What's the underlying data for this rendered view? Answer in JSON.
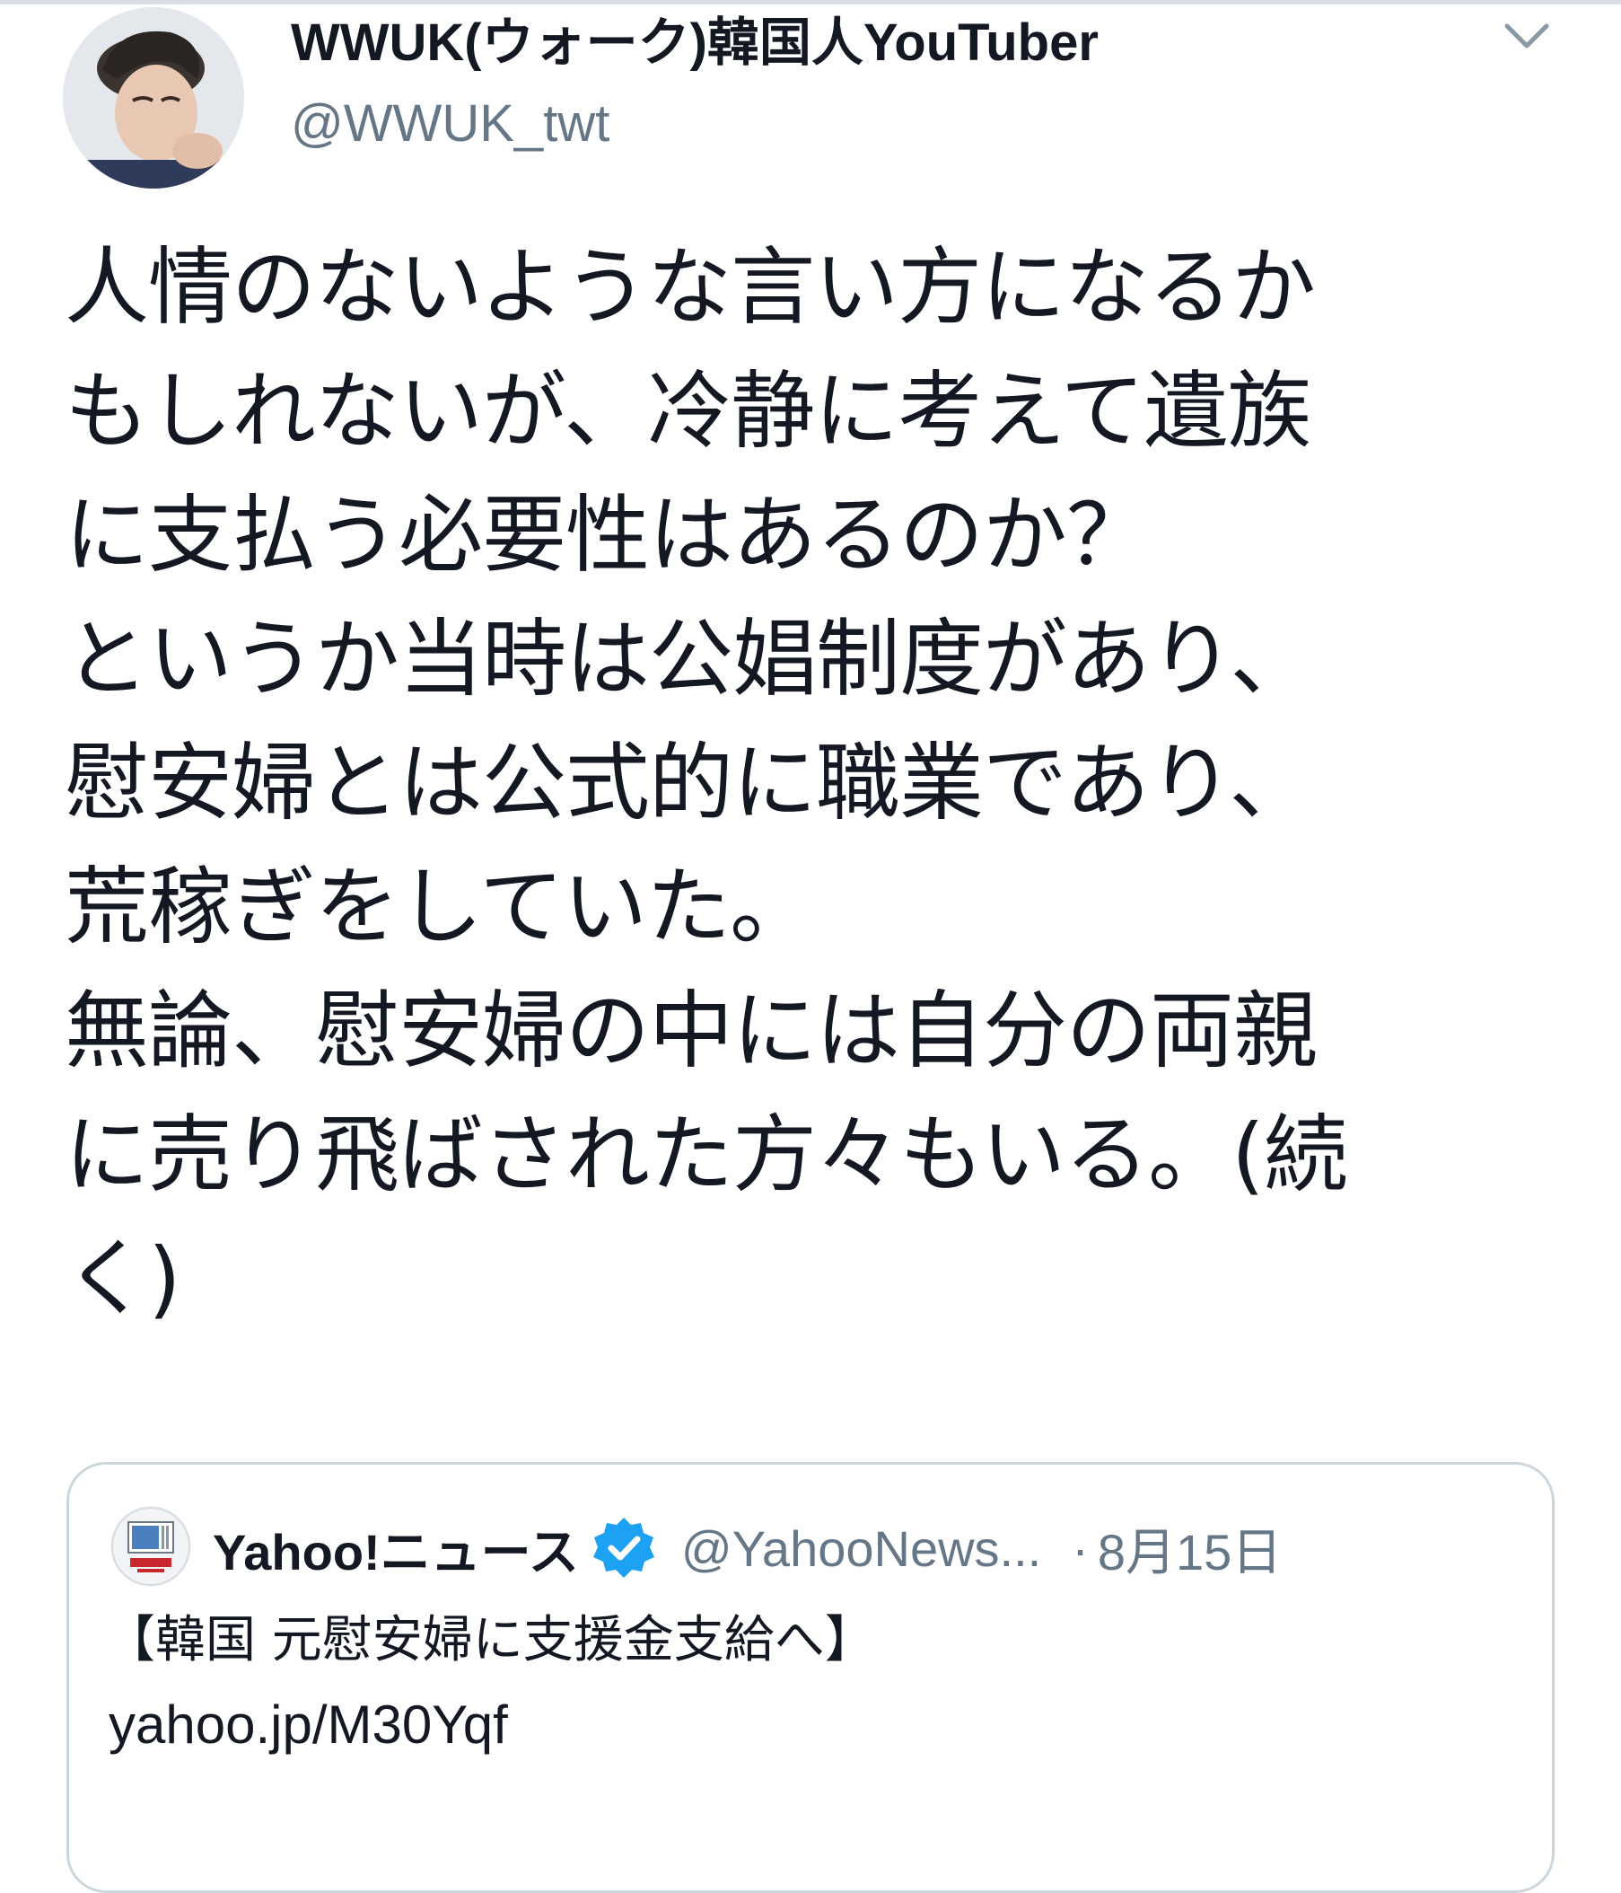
{
  "tweet": {
    "author": {
      "display_name": "WWUK(ウォーク)韓国人YouTuber",
      "handle": "@WWUK_twt",
      "avatar_icon": "profile-photo"
    },
    "more_icon": "chevron-down-icon",
    "text": "人情のないような言い方になるか\nもしれないが、冷静に考えて遺族\nに支払う必要性はあるのか？\nというか当時は公娼制度があり、\n慰安婦とは公式的に職業であり、\n荒稼ぎをしていた。\n無論、慰安婦の中には自分の両親\nに売り飛ばされた方々もいる。(続\nく)"
  },
  "quoted_tweet": {
    "author": {
      "display_name": "Yahoo!ニュース",
      "handle": "@YahooNews...",
      "verified": true,
      "avatar_icon": "yahoo-news-logo"
    },
    "separator": "·",
    "date": "8月15日",
    "text": "【韓国 元慰安婦に支援金支給へ】",
    "link": "yahoo.jp/M30Yqf"
  },
  "colors": {
    "text_primary": "#141823",
    "text_secondary": "#657786",
    "border": "#ccd6dd",
    "verified": "#1da1f2"
  }
}
